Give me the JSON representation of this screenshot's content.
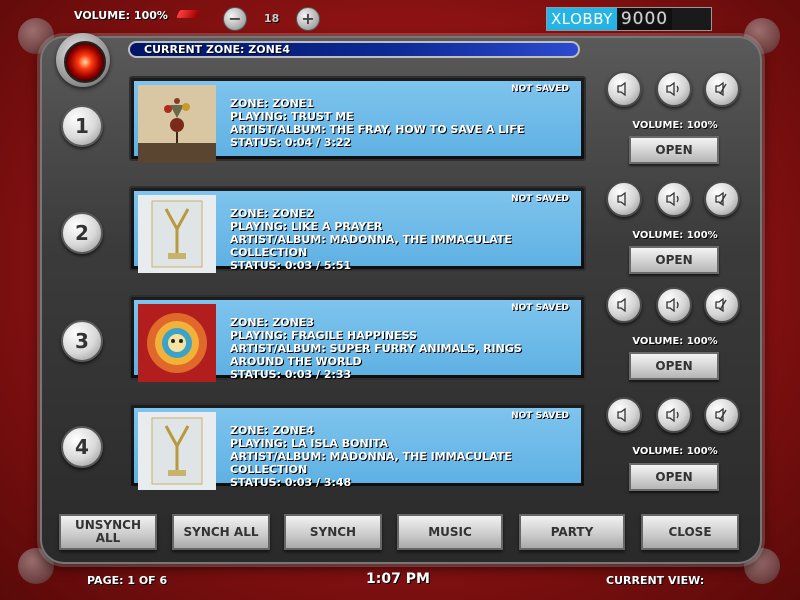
{
  "topbar": {
    "volume_label": "VOLUME: 100%",
    "minus_symbol": "−",
    "plus_symbol": "+",
    "number": "18",
    "brand_a": "XLOBBY",
    "brand_b": "9000"
  },
  "current_zone": "CURRENT ZONE: ZONE4",
  "zones": [
    {
      "num": "1",
      "not_saved": "NOT SAVED",
      "zone": "ZONE: ZONE1",
      "playing": "PLAYING: TRUST ME",
      "artist": "ARTIST/ALBUM: THE FRAY, HOW TO SAVE A LIFE",
      "status": "STATUS: 0:04 / 3:22",
      "volume": "VOLUME: 100%",
      "open": "OPEN"
    },
    {
      "num": "2",
      "not_saved": "NOT SAVED",
      "zone": "ZONE: ZONE2",
      "playing": "PLAYING: LIKE A PRAYER",
      "artist": "ARTIST/ALBUM: MADONNA, THE IMMACULATE COLLECTION",
      "status": "STATUS: 0:03 / 5:51",
      "volume": "VOLUME: 100%",
      "open": "OPEN"
    },
    {
      "num": "3",
      "not_saved": "NOT SAVED",
      "zone": "ZONE: ZONE3",
      "playing": "PLAYING: FRAGILE HAPPINESS",
      "artist": "ARTIST/ALBUM: SUPER FURRY ANIMALS, RINGS AROUND THE WORLD",
      "status": "STATUS: 0:03 / 2:33",
      "volume": "VOLUME: 100%",
      "open": "OPEN"
    },
    {
      "num": "4",
      "not_saved": "NOT SAVED",
      "zone": "ZONE: ZONE4",
      "playing": "PLAYING: LA ISLA BONITA",
      "artist": "ARTIST/ALBUM: MADONNA, THE IMMACULATE COLLECTION",
      "status": "STATUS: 0:03 / 3:48",
      "volume": "VOLUME: 100%",
      "open": "OPEN"
    }
  ],
  "bottom_buttons": {
    "unsynch_all": "UNSYNCH ALL",
    "synch_all": "SYNCH ALL",
    "synch": "SYNCH",
    "music": "MUSIC",
    "party": "PARTY",
    "close": "CLOSE"
  },
  "footer": {
    "page": "PAGE: 1 OF 6",
    "time": "1:07 PM",
    "current_view": "CURRENT VIEW:"
  },
  "album_art": {
    "fray_text": "the fray",
    "fray_sub": "how to save a life",
    "madonna_text": "IMMACULATE",
    "madonna_sub": "Madonna"
  }
}
